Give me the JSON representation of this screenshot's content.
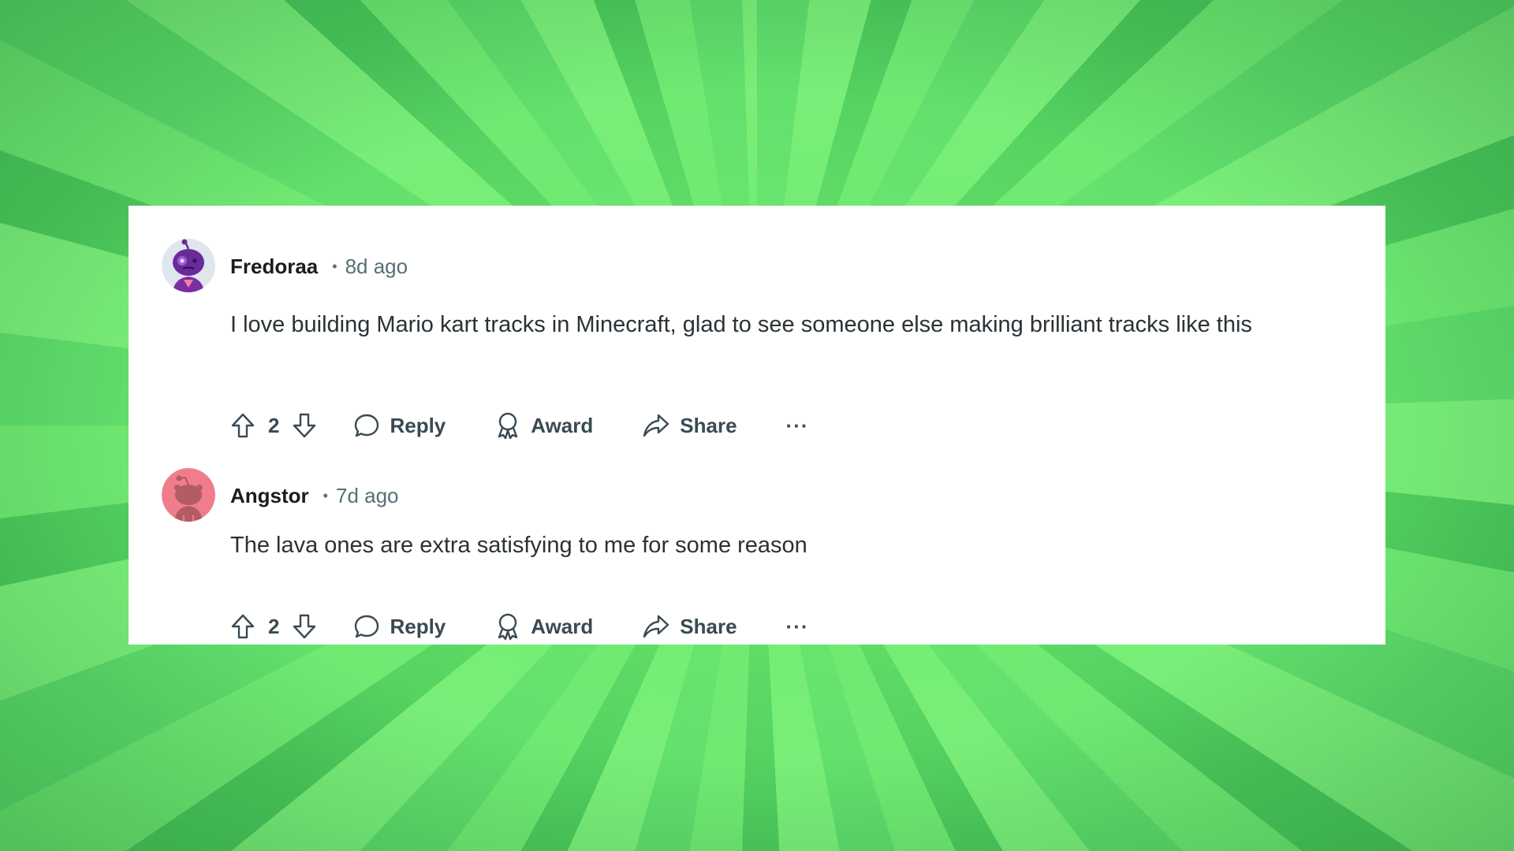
{
  "colors": {
    "background": "#6be572",
    "card": "#ffffff",
    "username": "#1c1c1c",
    "meta": "#576f76",
    "body_text": "#2a3236",
    "action": "#3a4a52"
  },
  "comments": [
    {
      "username": "Fredoraa",
      "separator": "•",
      "time": "8d ago",
      "avatar_icon": "snoo-avatar-purple",
      "body": "I love building Mario kart tracks in Minecraft, glad to see someone else making brilliant tracks like this",
      "score": "2",
      "reply_label": "Reply",
      "award_label": "Award",
      "share_label": "Share",
      "more_label": "···"
    },
    {
      "username": "Angstor",
      "separator": "•",
      "time": "7d ago",
      "avatar_icon": "snoo-avatar-default-pink",
      "body": "The lava ones are extra satisfying to me for some reason",
      "score": "2",
      "reply_label": "Reply",
      "award_label": "Award",
      "share_label": "Share",
      "more_label": "···"
    }
  ]
}
